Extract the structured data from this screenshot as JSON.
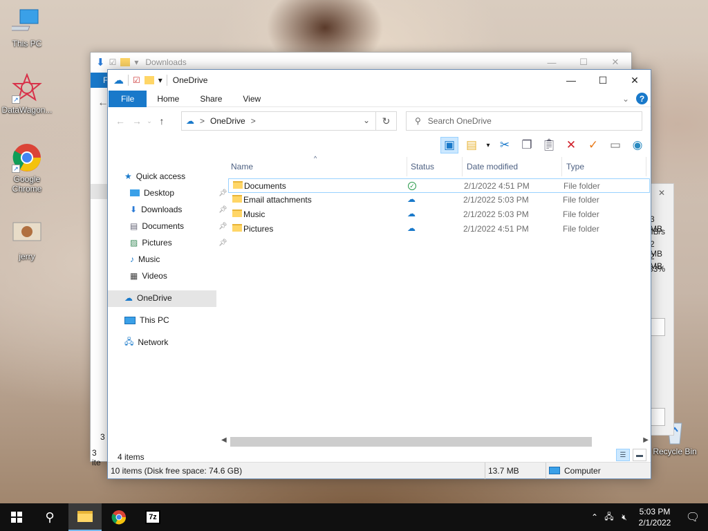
{
  "desktop": {
    "icons": [
      {
        "label": "This PC"
      },
      {
        "label": "DataWagon..."
      },
      {
        "label": "Google Chrome"
      },
      {
        "label": "jerry"
      },
      {
        "label": "Recycle Bin"
      }
    ]
  },
  "back_window": {
    "title": "Downloads",
    "file_tab": "F",
    "status_count": "3 ite",
    "status_count_2": "3 i"
  },
  "side_dialog": {
    "lines": [
      "3 MB",
      "MB/s",
      "2 MB",
      "2 MB",
      "33%"
    ]
  },
  "window": {
    "title": "OneDrive",
    "ribbon_tabs": [
      "File",
      "Home",
      "Share",
      "View"
    ],
    "address": {
      "crumb": "OneDrive",
      "sep": ">"
    },
    "search": {
      "placeholder": "Search OneDrive"
    },
    "columns": {
      "name": "Name",
      "status": "Status",
      "date": "Date modified",
      "type": "Type"
    },
    "nav": {
      "quick_access": "Quick access",
      "items": [
        {
          "label": "Desktop",
          "pinned": true
        },
        {
          "label": "Downloads",
          "pinned": true
        },
        {
          "label": "Documents",
          "pinned": true
        },
        {
          "label": "Pictures",
          "pinned": true
        },
        {
          "label": "Music",
          "pinned": false
        },
        {
          "label": "Videos",
          "pinned": false
        }
      ],
      "onedrive": "OneDrive",
      "this_pc": "This PC",
      "network": "Network"
    },
    "files": [
      {
        "name": "Documents",
        "status": "synced",
        "date": "2/1/2022 4:51 PM",
        "type": "File folder"
      },
      {
        "name": "Email attachments",
        "status": "cloud",
        "date": "2/1/2022 5:03 PM",
        "type": "File folder"
      },
      {
        "name": "Music",
        "status": "cloud",
        "date": "2/1/2022 5:03 PM",
        "type": "File folder"
      },
      {
        "name": "Pictures",
        "status": "cloud",
        "date": "2/1/2022 4:51 PM",
        "type": "File folder"
      }
    ],
    "item_count": "4 items",
    "statusbar": {
      "left": "10 items (Disk free space: 74.6 GB)",
      "size": "13.7 MB",
      "location": "Computer"
    }
  },
  "taskbar": {
    "time": "5:03 PM",
    "date": "2/1/2022",
    "zip_label": "7z"
  }
}
